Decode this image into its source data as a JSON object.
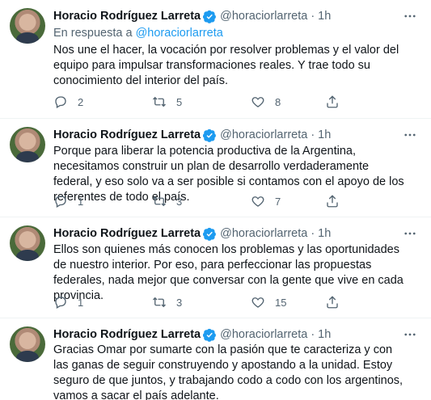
{
  "tweets": [
    {
      "name": "Horacio Rodríguez Larreta",
      "handle": "@horaciorlarreta",
      "dot": "·",
      "time": "1h",
      "reply_prefix": "En respuesta a ",
      "reply_handle": "@horaciorlarreta",
      "text": "Nos une el hacer, la vocación por resolver problemas y el valor del equipo para impulsar transformaciones reales. Y trae todo su conocimiento del interior del país.",
      "replies": "2",
      "retweets": "5",
      "likes": "8"
    },
    {
      "name": "Horacio Rodríguez Larreta",
      "handle": "@horaciorlarreta",
      "dot": "·",
      "time": "1h",
      "text": "Porque para liberar la potencia productiva de la Argentina, necesitamos construir un plan de desarrollo verdaderamente federal, y eso solo va a ser posible si contamos con el apoyo de los referentes de todo el país.",
      "replies": "1",
      "retweets": "3",
      "likes": "7"
    },
    {
      "name": "Horacio Rodríguez Larreta",
      "handle": "@horaciorlarreta",
      "dot": "·",
      "time": "1h",
      "text": "Ellos son quienes más conocen los problemas y las oportunidades de nuestro interior. Por eso, para perfeccionar las propuestas federales, nada mejor que conversar con la gente que vive en cada provincia.",
      "replies": "1",
      "retweets": "3",
      "likes": "15"
    },
    {
      "name": "Horacio Rodríguez Larreta",
      "handle": "@horaciorlarreta",
      "dot": "·",
      "time": "1h",
      "text": "Gracias Omar por sumarte con la pasión que te caracteriza y con las ganas de seguir construyendo y apostando a la unidad. Estoy seguro de que juntos, y trabajando codo a codo con los argentinos, vamos a sacar el país adelante."
    }
  ],
  "colors": {
    "accent": "#1d9bf0",
    "muted": "#536471",
    "text": "#0f1419"
  },
  "icons": {
    "verified": "verified-badge-icon",
    "more": "more-icon",
    "reply": "reply-icon",
    "retweet": "retweet-icon",
    "like": "heart-icon",
    "share": "share-icon"
  }
}
